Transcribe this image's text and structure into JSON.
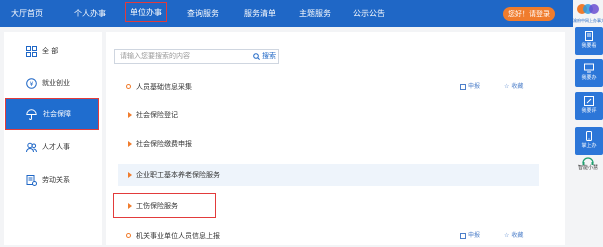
{
  "nav": {
    "items": [
      "大厅首页",
      "个人办事",
      "单位办事",
      "查询服务",
      "服务清单",
      "主题服务",
      "公示公告"
    ],
    "active": "单位办事",
    "login": "您好！请登录"
  },
  "sidebar": {
    "items": [
      {
        "label": "全 部",
        "icon": "grid-icon"
      },
      {
        "label": "就业创业",
        "icon": "employment-icon"
      },
      {
        "label": "社会保障",
        "icon": "umbrella-icon"
      },
      {
        "label": "人才人事",
        "icon": "people-icon"
      },
      {
        "label": "劳动关系",
        "icon": "contract-icon"
      }
    ],
    "active": "社会保障"
  },
  "search": {
    "placeholder": "请输入您要搜索的内容",
    "button": "搜索"
  },
  "rows": [
    {
      "label": "人员基础信息采集",
      "bullet": "dot",
      "apply": "申报",
      "fav": "收藏"
    },
    {
      "label": "社会保险登记",
      "bullet": "triangle"
    },
    {
      "label": "社会保险缴费申报",
      "bullet": "triangle"
    },
    {
      "label": "企业职工基本养老保险服务",
      "bullet": "triangle",
      "highlight": true
    },
    {
      "label": "工伤保险服务",
      "bullet": "triangle",
      "boxed": true
    },
    {
      "label": "机关事业单位人员信息上报",
      "bullet": "dot",
      "apply": "申报",
      "fav": "收藏"
    }
  ],
  "rightbar": {
    "logo_text": "渝府中网上办事大厅",
    "buttons": [
      "我要看",
      "我要办",
      "我要评",
      "掌上办"
    ],
    "assistant": "智能小慧"
  },
  "colors": {
    "nav_bg": "#1f67c6",
    "accent_orange": "#f07c2d",
    "highlight_red": "#e23b3b"
  }
}
